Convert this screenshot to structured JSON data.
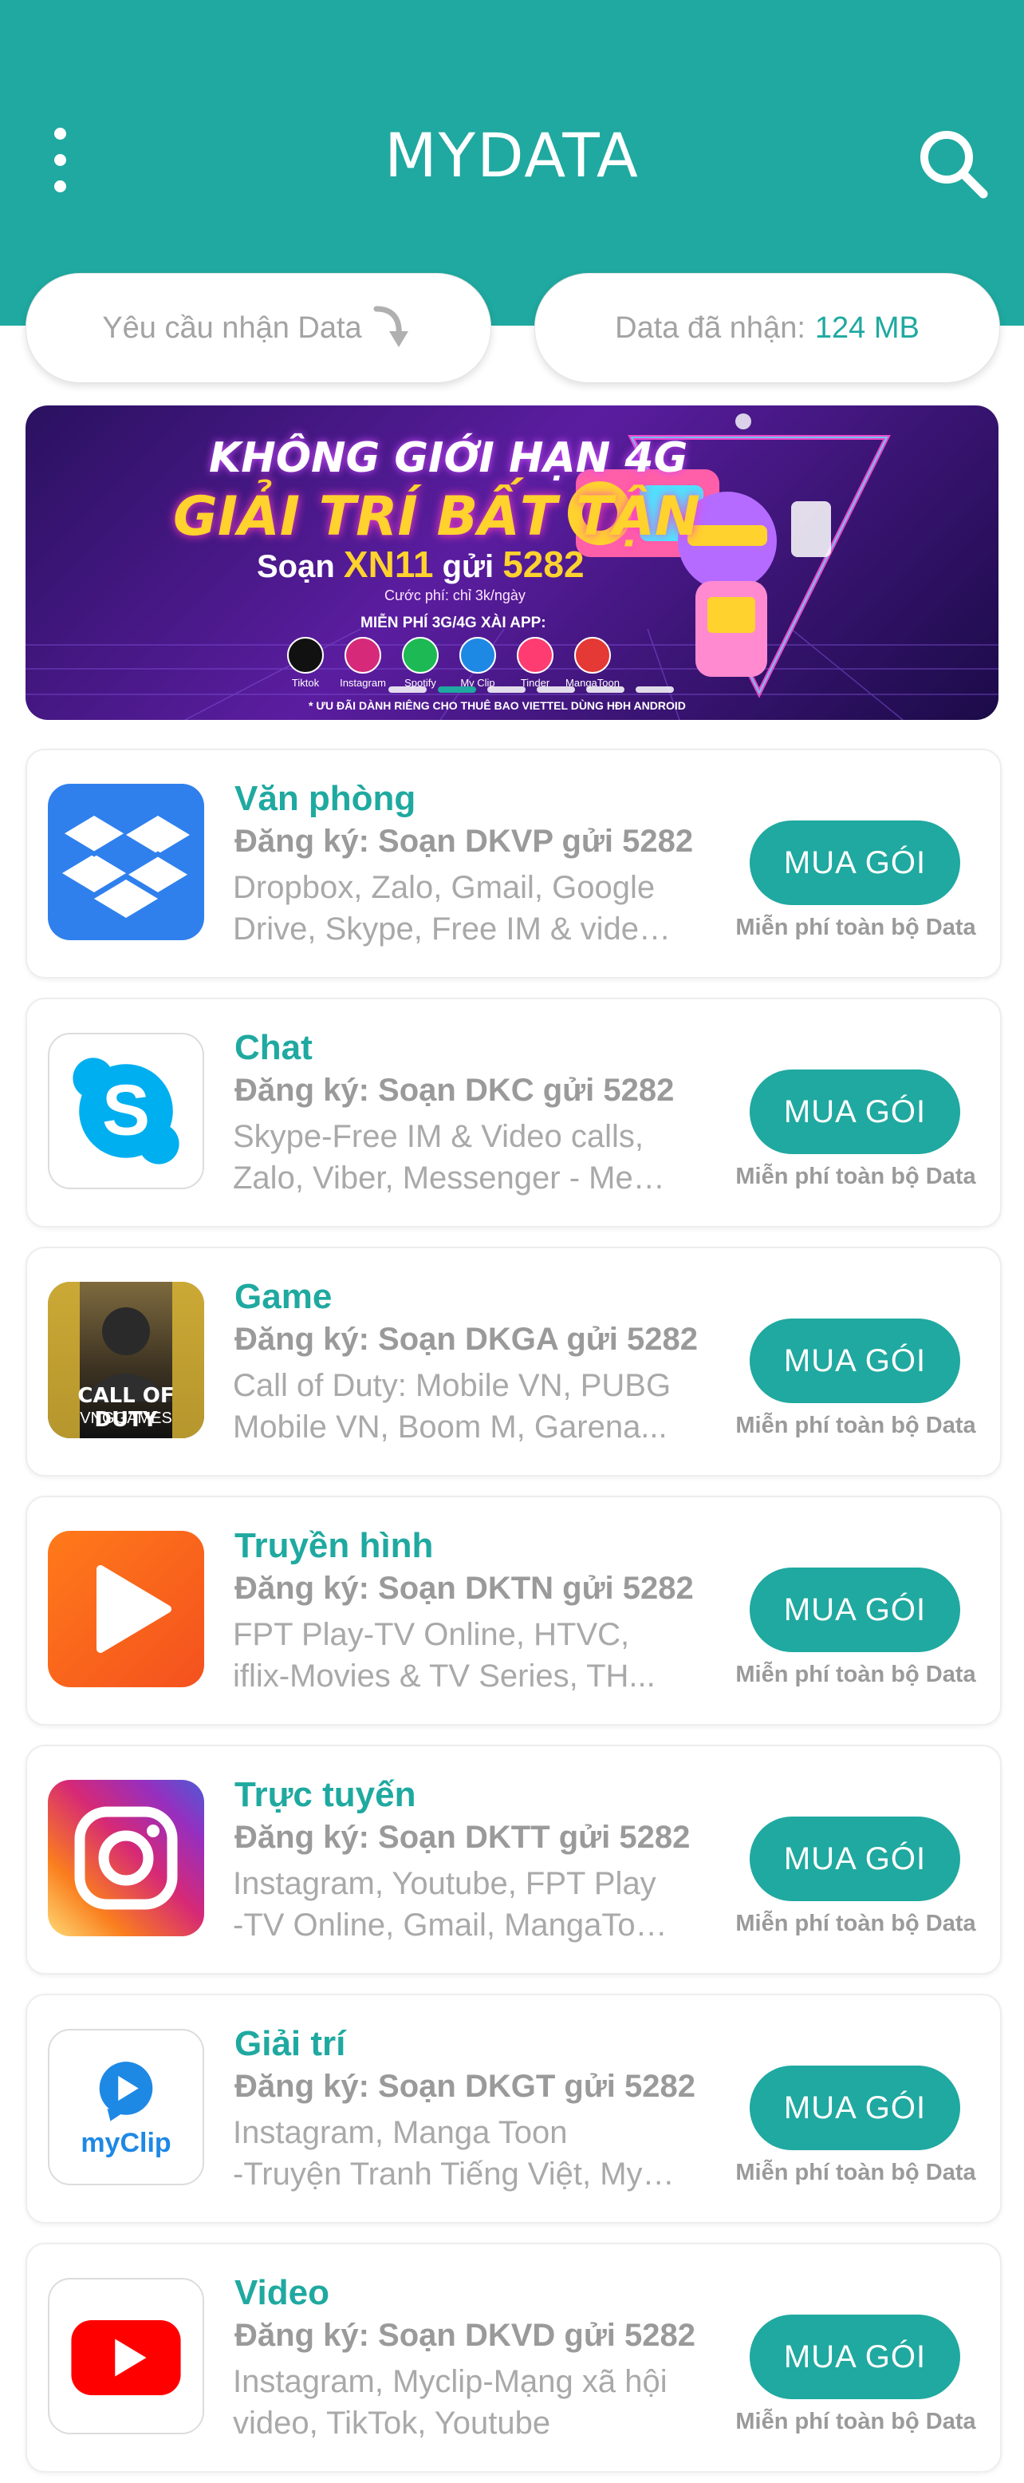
{
  "header": {
    "title": "MYDATA"
  },
  "request_pill": {
    "label": "Yêu cầu nhận Data"
  },
  "received_pill": {
    "label": "Data đã nhận:",
    "value": "124 MB"
  },
  "banner": {
    "line1": "KHÔNG GIỚI HẠN 4G",
    "line2": "GIẢI TRÍ BẤT TẬN",
    "sms_prefix": "Soạn",
    "sms_code": "XN11",
    "sms_mid": "gửi",
    "sms_number": "5282",
    "fee": "Cước phí: chỉ 3k/ngày",
    "free_apps_title": "MIỄN PHÍ 3G/4G XÀI APP:",
    "apps": [
      "Tiktok",
      "Instagram",
      "Spotify",
      "My Clip",
      "Tinder",
      "MangaToon"
    ],
    "note": "* ƯU ĐÃI DÀNH RIÊNG CHO THUÊ BAO VIETTEL DÙNG HĐH ANDROID"
  },
  "packages": [
    {
      "title": "Văn phòng",
      "register": "Đăng ký: Soạn DKVP gửi 5282",
      "desc_line1": "Dropbox, Zalo, Gmail, Google",
      "desc_line2": "Drive, Skype, Free IM & video...",
      "button": "MUA GÓI",
      "free": "Miễn phí toàn bộ Data",
      "icon": "dropbox-icon"
    },
    {
      "title": "Chat",
      "register": "Đăng ký: Soạn DKC gửi 5282",
      "desc_line1": "Skype-Free IM & Video calls,",
      "desc_line2": "Zalo, Viber, Messenger - Mess...",
      "button": "MUA GÓI",
      "free": "Miễn phí toàn bộ Data",
      "icon": "skype-icon"
    },
    {
      "title": "Game",
      "register": "Đăng ký: Soạn DKGA gửi 5282",
      "desc_line1": "Call of Duty: Mobile VN, PUBG",
      "desc_line2": "Mobile VN, Boom M, Garena...",
      "button": "MUA GÓI",
      "free": "Miễn phí toàn bộ Data",
      "icon": "call-of-duty-icon",
      "icon_text1": "CALL OF DUTY",
      "icon_text2": "VNGGAMES"
    },
    {
      "title": "Truyền hình",
      "register": "Đăng ký: Soạn DKTN gửi 5282",
      "desc_line1": "FPT Play-TV Online, HTVC,",
      "desc_line2": "iflix-Movies & TV Series, TH...",
      "button": "MUA GÓI",
      "free": "Miễn phí toàn bộ Data",
      "icon": "play-icon"
    },
    {
      "title": "Trực tuyến",
      "register": "Đăng ký: Soạn DKTT gửi 5282",
      "desc_line1": "Instagram, Youtube, FPT Play",
      "desc_line2": "-TV Online, Gmail, MangaToon...",
      "button": "MUA GÓI",
      "free": "Miễn phí toàn bộ Data",
      "icon": "instagram-icon"
    },
    {
      "title": "Giải trí",
      "register": "Đăng ký: Soạn DKGT gửi 5282",
      "desc_line1": "Instagram, Manga Toon",
      "desc_line2": "-Truyện Tranh Tiếng Việt, MyC...",
      "button": "MUA GÓI",
      "free": "Miễn phí toàn bộ Data",
      "icon": "myclip-icon",
      "icon_text1": "myClip"
    },
    {
      "title": "Video",
      "register": "Đăng ký: Soạn DKVD gửi 5282",
      "desc_line1": "Instagram, Myclip-Mạng xã hội",
      "desc_line2": "video, TikTok, Youtube",
      "button": "MUA GÓI",
      "free": "Miễn phí toàn bộ Data",
      "icon": "youtube-icon"
    }
  ],
  "colors": {
    "primary": "#1fa9a0",
    "muted_text": "#9a9a9a"
  }
}
